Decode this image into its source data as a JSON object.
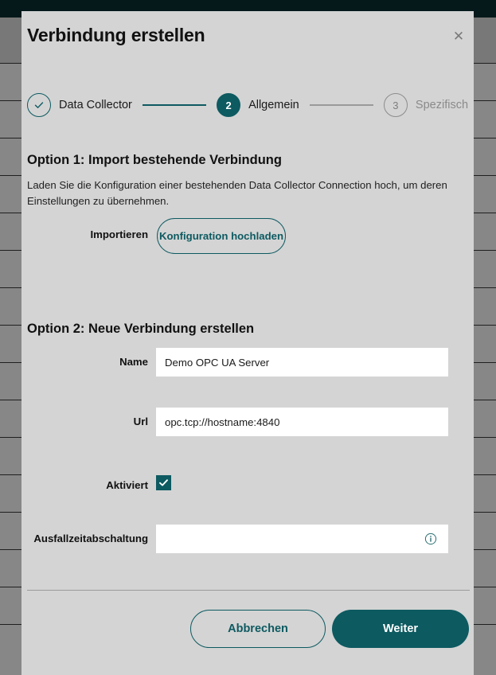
{
  "background": {
    "topbar_color": "#0a3034",
    "row_count": 16
  },
  "modal": {
    "title": "Verbindung erstellen",
    "close_label": "✕",
    "surface_color": "#d4d4d4",
    "accent_color": "#0d5a61"
  },
  "stepper": {
    "steps": [
      {
        "indicator": "✓",
        "label": "Data Collector",
        "state": "done"
      },
      {
        "indicator": "2",
        "label": "Allgemein",
        "state": "current"
      },
      {
        "indicator": "3",
        "label": "Spezifisch",
        "state": "todo"
      }
    ]
  },
  "option1": {
    "title": "Option 1: Import bestehende Verbindung",
    "description": "Laden Sie die Konfiguration einer bestehenden Data Collector Connection hoch, um deren Einstellungen zu übernehmen.",
    "import_label": "Importieren",
    "upload_button": "Konfiguration hochladen"
  },
  "option2": {
    "title": "Option 2: Neue Verbindung erstellen",
    "fields": {
      "name": {
        "label": "Name",
        "value": "Demo OPC UA Server",
        "placeholder": ""
      },
      "url": {
        "label": "Url",
        "value": "opc.tcp://hostname:4840",
        "placeholder": ""
      },
      "aktiviert": {
        "label": "Aktiviert",
        "checked": true
      },
      "ausfallzeitabschaltung": {
        "label": "Ausfallzeitabschaltung",
        "value": "",
        "placeholder": "",
        "info_icon": "info-icon"
      }
    }
  },
  "footer": {
    "cancel_label": "Abbrechen",
    "next_label": "Weiter"
  }
}
